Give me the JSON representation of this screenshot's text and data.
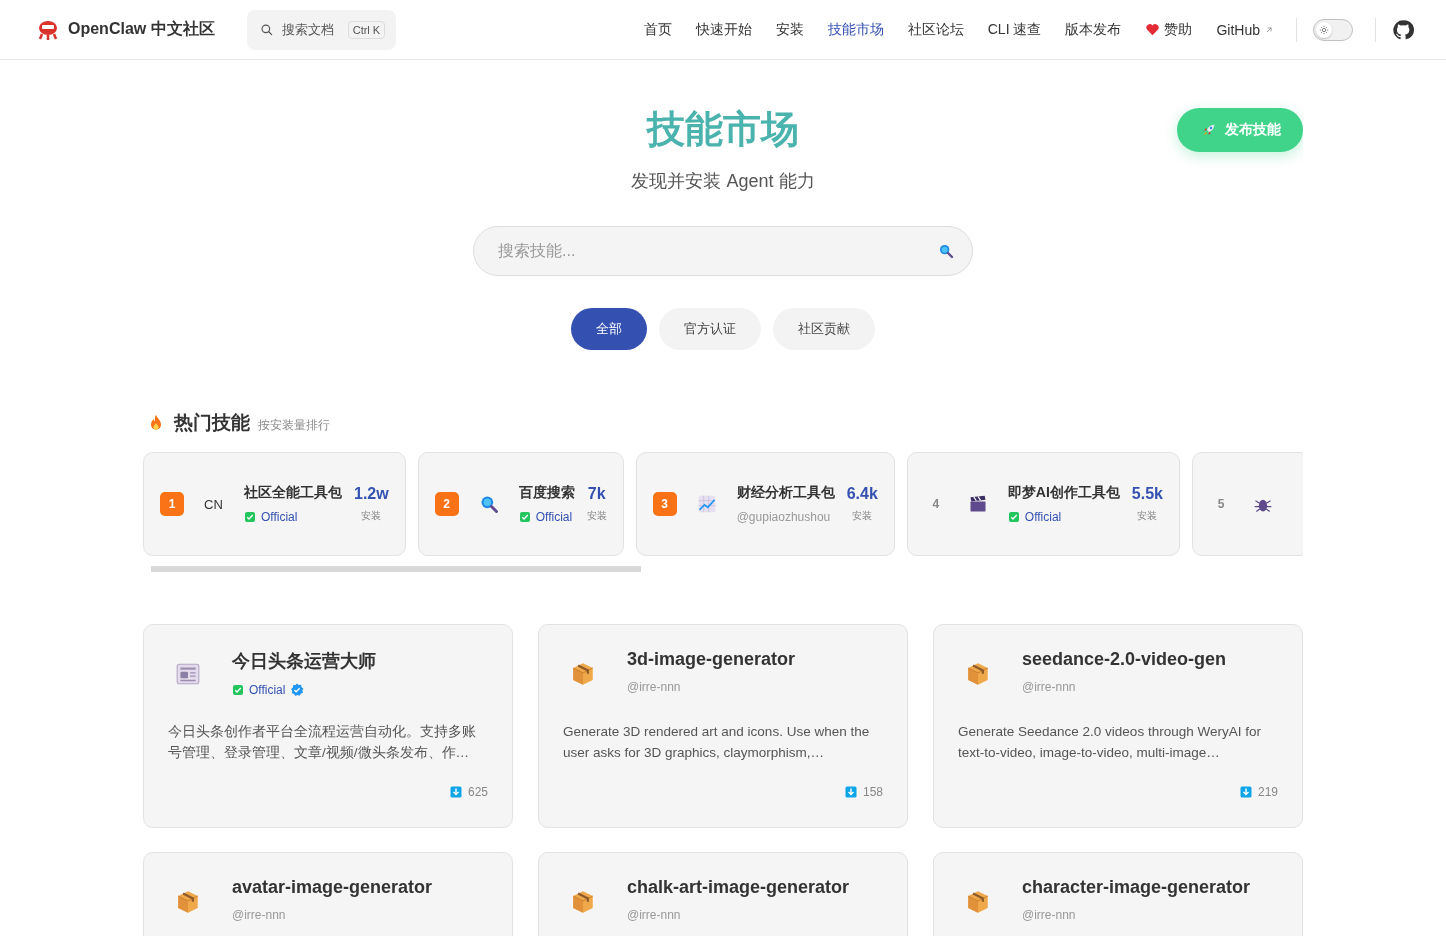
{
  "header": {
    "brand": "OpenClaw 中文社区",
    "search": {
      "placeholder": "搜索文档",
      "shortcut": "Ctrl K"
    },
    "nav": [
      {
        "label": "首页",
        "selected": false,
        "kind": "link"
      },
      {
        "label": "快速开始",
        "selected": false,
        "kind": "link"
      },
      {
        "label": "安装",
        "selected": false,
        "kind": "link"
      },
      {
        "label": "技能市场",
        "selected": true,
        "kind": "link"
      },
      {
        "label": "社区论坛",
        "selected": false,
        "kind": "link"
      },
      {
        "label": "CLI 速查",
        "selected": false,
        "kind": "link"
      },
      {
        "label": "版本发布",
        "selected": false,
        "kind": "link"
      },
      {
        "label": "赞助",
        "selected": false,
        "kind": "sponsor"
      },
      {
        "label": "GitHub",
        "selected": false,
        "kind": "external"
      }
    ],
    "dark_mode": false
  },
  "hero": {
    "title": "技能市场",
    "subtitle": "发现并安装 Agent 能力",
    "publish_button": "发布技能",
    "search": {
      "placeholder": "搜索技能..."
    },
    "filters": [
      {
        "label": "全部",
        "selected": true
      },
      {
        "label": "官方认证",
        "selected": false
      },
      {
        "label": "社区贡献",
        "selected": false
      }
    ]
  },
  "hot": {
    "title": "热门技能",
    "subtitle": "按安装量排行",
    "items": [
      {
        "rank": "1",
        "top": true,
        "kind": "text",
        "icon_text": "CN",
        "name": "社区全能工具包",
        "official": "Official",
        "count": "1.2w",
        "unit": "安装"
      },
      {
        "rank": "2",
        "top": true,
        "kind": "magnifier",
        "name": "百度搜索",
        "official": "Official",
        "count": "7k",
        "unit": "安装"
      },
      {
        "rank": "3",
        "top": true,
        "kind": "chart",
        "name": "财经分析工具包",
        "author": "@gupiaozhushou",
        "count": "6.4k",
        "unit": "安装"
      },
      {
        "rank": "4",
        "top": false,
        "kind": "clapper",
        "name": "即梦AI创作工具包",
        "official": "Official",
        "count": "5.5k",
        "unit": "安装"
      },
      {
        "rank": "5",
        "top": false,
        "kind": "bug"
      }
    ]
  },
  "skills": [
    {
      "kind": "newspaper",
      "name": "今日头条运营大师",
      "official": "Official",
      "verified": true,
      "description": "今日头条创作者平台全流程运营自动化。支持多账号管理、登录管理、文章/视频/微头条发布、作…",
      "downloads": "625"
    },
    {
      "kind": "box",
      "name": "3d-image-generator",
      "author": "@irre-nnn",
      "description": "Generate 3D rendered art and icons. Use when the user asks for 3D graphics, claymorphism,…",
      "downloads": "158"
    },
    {
      "kind": "box",
      "name": "seedance-2.0-video-gen",
      "author": "@irre-nnn",
      "description": "Generate Seedance 2.0 videos through WeryAI for text-to-video, image-to-video, multi-image…",
      "downloads": "219"
    },
    {
      "kind": "box",
      "name": "avatar-image-generator",
      "author": "@irre-nnn"
    },
    {
      "kind": "box",
      "name": "chalk-art-image-generator",
      "author": "@irre-nnn"
    },
    {
      "kind": "box",
      "name": "character-image-generator",
      "author": "@irre-nnn"
    }
  ]
}
